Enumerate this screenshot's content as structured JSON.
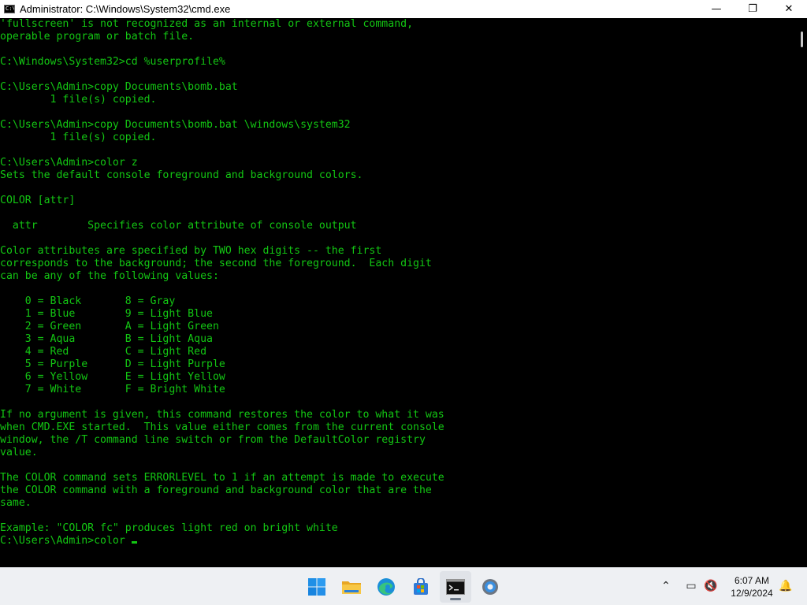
{
  "window": {
    "title": "Administrator: C:\\Windows\\System32\\cmd.exe",
    "icon_text": "C:\\",
    "minimize_glyph": "—",
    "maximize_glyph": "❐",
    "close_glyph": "✕"
  },
  "console": {
    "foreground": "#13c613",
    "background": "#000000",
    "output": "'fullscreen' is not recognized as an internal or external command,\noperable program or batch file.\n\nC:\\Windows\\System32>cd %userprofile%\n\nC:\\Users\\Admin>copy Documents\\bomb.bat\n        1 file(s) copied.\n\nC:\\Users\\Admin>copy Documents\\bomb.bat \\windows\\system32\n        1 file(s) copied.\n\nC:\\Users\\Admin>color z\nSets the default console foreground and background colors.\n\nCOLOR [attr]\n\n  attr        Specifies color attribute of console output\n\nColor attributes are specified by TWO hex digits -- the first\ncorresponds to the background; the second the foreground.  Each digit\ncan be any of the following values:\n\n    0 = Black       8 = Gray\n    1 = Blue        9 = Light Blue\n    2 = Green       A = Light Green\n    3 = Aqua        B = Light Aqua\n    4 = Red         C = Light Red\n    5 = Purple      D = Light Purple\n    6 = Yellow      E = Light Yellow\n    7 = White       F = Bright White\n\nIf no argument is given, this command restores the color to what it was\nwhen CMD.EXE started.  This value either comes from the current console\nwindow, the /T command line switch or from the DefaultColor registry\nvalue.\n\nThe COLOR command sets ERRORLEVEL to 1 if an attempt is made to execute\nthe COLOR command with a foreground and background color that are the\nsame.\n\nExample: \"COLOR fc\" produces light red on bright white\n",
    "prompt_line": "C:\\Users\\Admin>color"
  },
  "taskbar": {
    "apps": [
      {
        "name": "start",
        "icon": "windows-logo-icon"
      },
      {
        "name": "file-explorer",
        "icon": "folder-icon"
      },
      {
        "name": "edge",
        "icon": "edge-icon"
      },
      {
        "name": "store",
        "icon": "store-icon"
      },
      {
        "name": "terminal",
        "icon": "terminal-icon",
        "active": true
      },
      {
        "name": "settings",
        "icon": "gear-icon"
      }
    ],
    "tray": {
      "chevron_glyph": "⌃",
      "network_glyph": "▭",
      "volume_glyph": "🔇",
      "notification_glyph": "🔔"
    },
    "clock": {
      "time": "6:07 AM",
      "date": "12/9/2024"
    }
  }
}
